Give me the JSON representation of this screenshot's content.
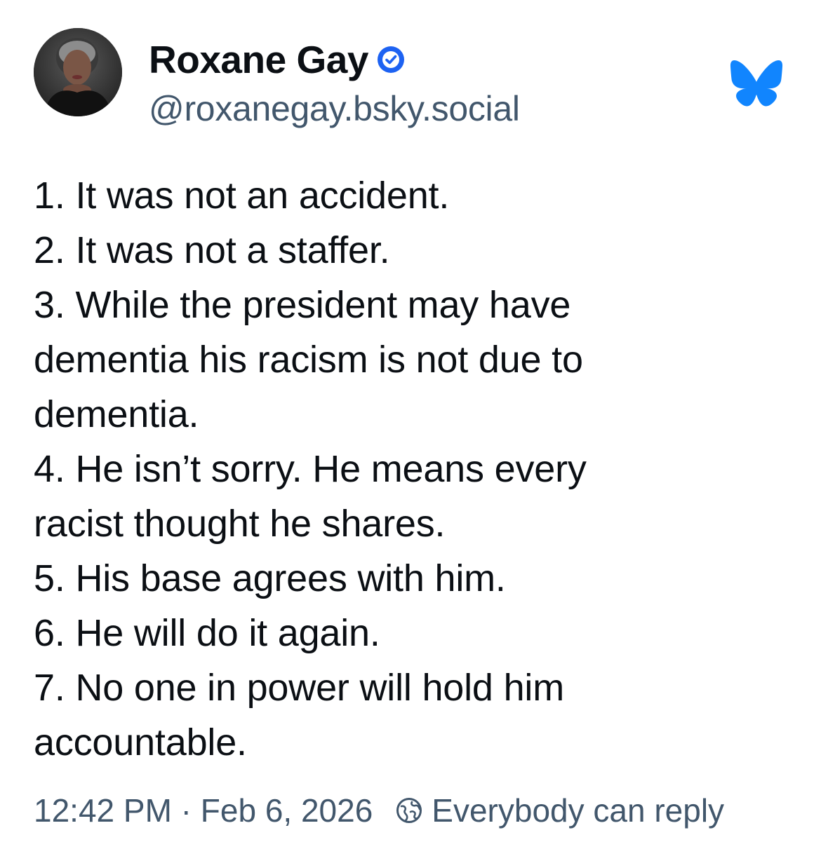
{
  "author": {
    "display_name": "Roxane Gay",
    "handle": "@roxanegay.bsky.social",
    "verified_icon": "verified-check-icon",
    "avatar": "profile-photo"
  },
  "brand": {
    "logo_icon": "bluesky-butterfly-icon",
    "accent_color": "#1185fe"
  },
  "post": {
    "lines": [
      "1. It was not an accident.",
      "2. It was not a staffer.",
      "3. While the president may have",
      "dementia his racism is not due to",
      "dementia.",
      "4. He isn’t sorry. He means every",
      "racist thought he shares.",
      "5. His base agrees with him.",
      "6. He will do it again.",
      "7. No one in power will hold him",
      "accountable."
    ]
  },
  "footer": {
    "timestamp": "12:42 PM · Feb 6, 2026",
    "reply_icon": "globe-reply-icon",
    "reply_setting": "Everybody can reply"
  }
}
